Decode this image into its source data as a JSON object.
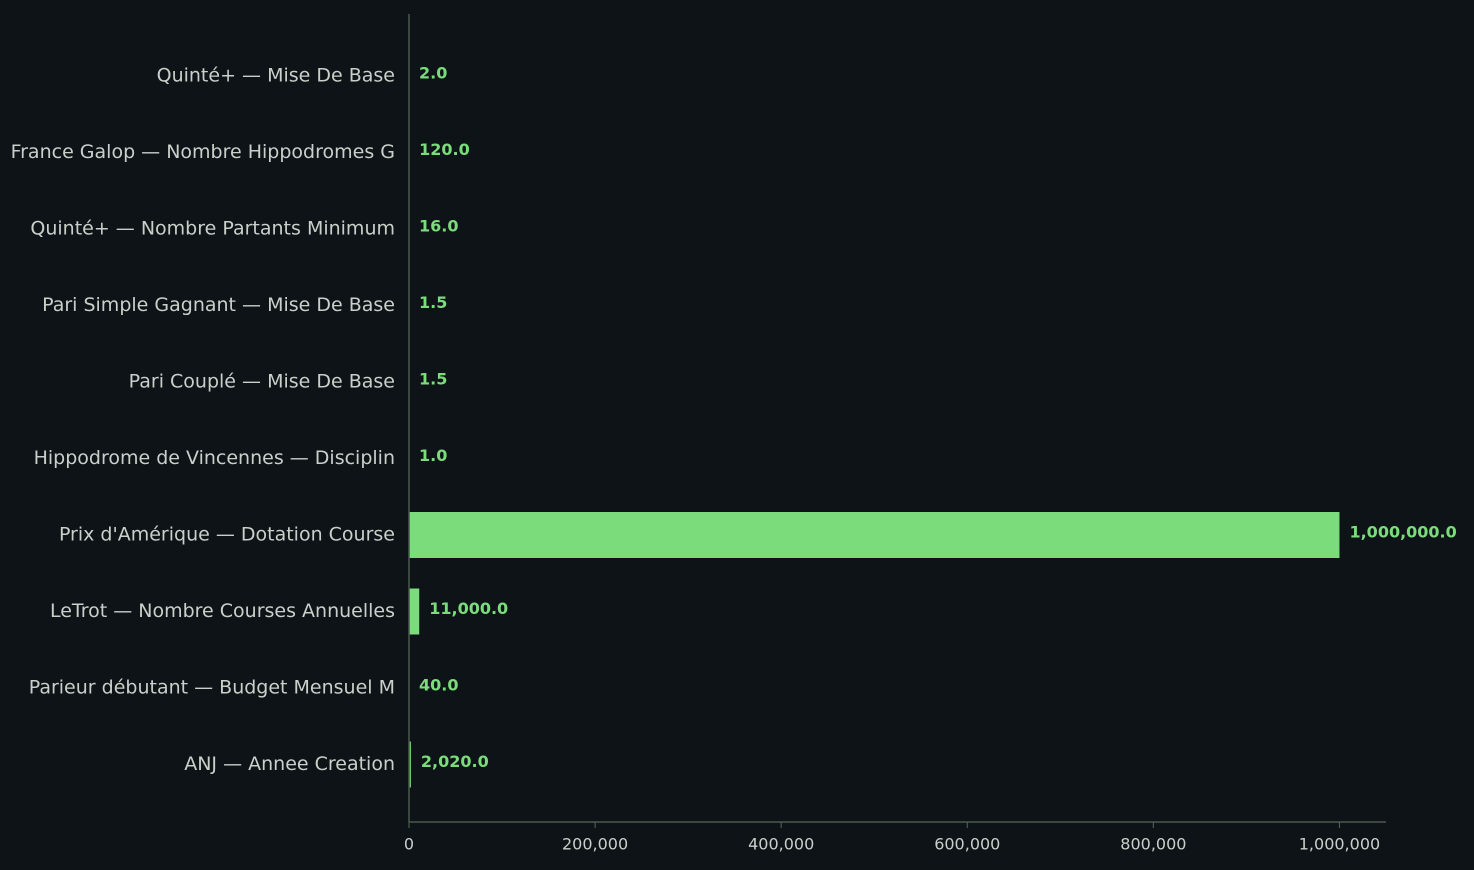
{
  "colors": {
    "background": "#0e1318",
    "bar": "#7bdc7b",
    "text": "#c9d0c9",
    "axis": "#4a5a4e"
  },
  "chart_data": {
    "type": "bar",
    "orientation": "horizontal",
    "title": "",
    "xlabel": "",
    "ylabel": "",
    "categories": [
      "Quinté+ — Mise De Base",
      "France Galop — Nombre Hippodromes G",
      "Quinté+ — Nombre Partants Minimum",
      "Pari Simple Gagnant — Mise De Base",
      "Pari Couplé — Mise De Base",
      "Hippodrome de Vincennes — Disciplin",
      "Prix d'Amérique — Dotation Course",
      "LeTrot — Nombre Courses Annuelles",
      "Parieur débutant — Budget Mensuel M",
      "ANJ — Annee Creation"
    ],
    "values": [
      2.0,
      120.0,
      16.0,
      1.5,
      1.5,
      1.0,
      1000000.0,
      11000.0,
      40.0,
      2020.0
    ],
    "value_labels": [
      "2.0",
      "120.0",
      "16.0",
      "1.5",
      "1.5",
      "1.0",
      "1,000,000.0",
      "11,000.0",
      "40.0",
      "2,020.0"
    ],
    "xlim": [
      0,
      1050000
    ],
    "xticks": [
      0,
      200000,
      400000,
      600000,
      800000,
      1000000
    ],
    "xtick_labels": [
      "0",
      "200,000",
      "400,000",
      "600,000",
      "800,000",
      "1,000,000"
    ],
    "grid": false,
    "legend": "none"
  }
}
